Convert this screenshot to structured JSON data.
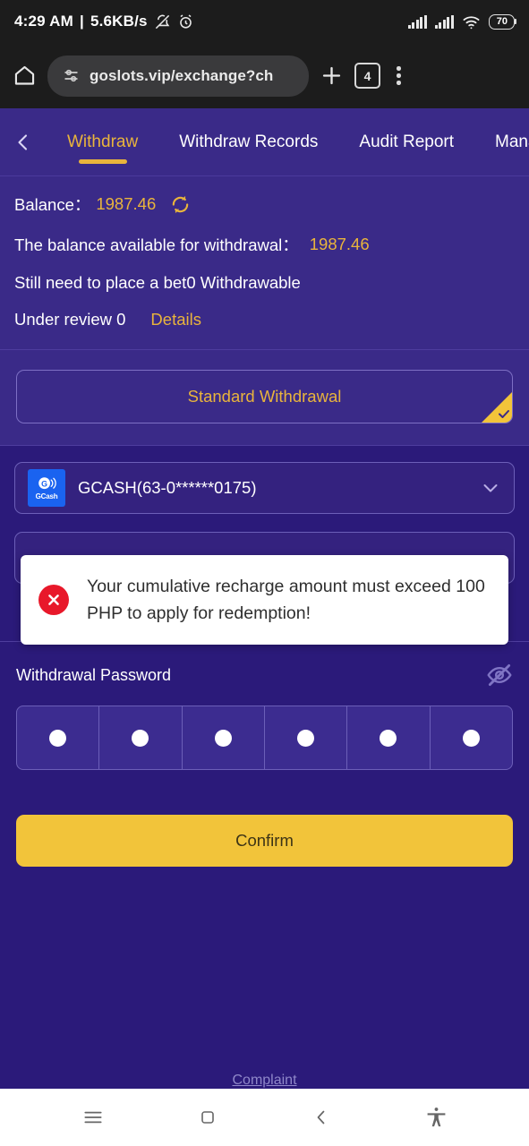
{
  "status_bar": {
    "time": "4:29 AM",
    "separator": "|",
    "network_speed": "5.6KB/s",
    "mute_icon": "bell-off-icon",
    "alarm_icon": "alarm-clock-icon",
    "signal_1_icon": "signal-bars-icon",
    "signal_2_icon": "signal-bars-icon",
    "wifi_icon": "wifi-icon",
    "battery_level": "70"
  },
  "browser": {
    "home_icon": "home-icon",
    "site_settings_icon": "site-settings-icon",
    "url": "goslots.vip/exchange?ch",
    "new_tab_icon": "plus-icon",
    "tab_count": "4",
    "menu_icon": "kebab-menu-icon"
  },
  "header": {
    "back_icon": "chevron-left-icon",
    "tabs": [
      {
        "label": "Withdraw",
        "active": true
      },
      {
        "label": "Withdraw Records",
        "active": false
      },
      {
        "label": "Audit Report",
        "active": false
      },
      {
        "label": "Manag",
        "active": false
      }
    ]
  },
  "balance": {
    "label": "Balance：",
    "value": "1987.46",
    "refresh_icon": "refresh-icon",
    "available_label": "The balance available for withdrawal：",
    "available_value": "1987.46",
    "bet_requirement": "Still need to place a bet0  Withdrawable",
    "under_review_label": "Under review 0",
    "details_link": "Details"
  },
  "withdrawal_type": {
    "standard_label": "Standard Withdrawal",
    "selected_icon": "check-corner-icon"
  },
  "payment_method": {
    "logo_icon": "gcash-logo-icon",
    "logo_text": "GCash",
    "account": "GCASH(63-0******0175)",
    "chevron_icon": "chevron-down-icon"
  },
  "amount_field": {
    "value": "",
    "placeholder": ""
  },
  "toast": {
    "icon": "error-circle-icon",
    "message": "Your cumulative recharge amount must exceed 100 PHP to apply for redemption!"
  },
  "password": {
    "label": "Withdrawal Password",
    "visibility_icon": "eye-off-icon",
    "cells": [
      "●",
      "●",
      "●",
      "●",
      "●",
      "●"
    ]
  },
  "confirm_button": {
    "label": "Confirm"
  },
  "footer": {
    "complaint_link": "Complaint"
  },
  "nav_bar": {
    "recents_icon": "hamburger-menu-icon",
    "home_icon": "square-home-icon",
    "back_icon": "chevron-left-icon",
    "accessibility_icon": "accessibility-icon"
  },
  "colors": {
    "accent_yellow": "#e9b43c",
    "button_yellow": "#f2c43a",
    "bg_dark_purple": "#2b1a7a",
    "bg_light_purple": "#3a2a88",
    "error_red": "#e8182a"
  }
}
